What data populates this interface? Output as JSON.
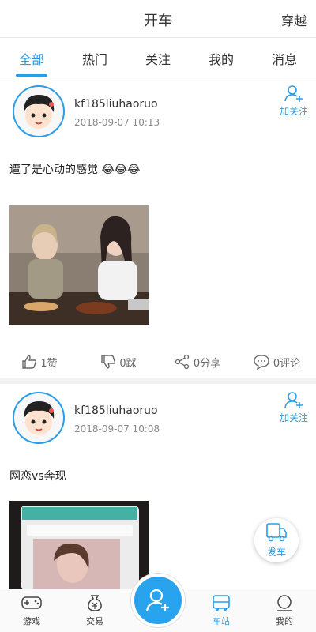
{
  "header": {
    "title": "开车",
    "action": "穿越"
  },
  "tabs": [
    {
      "label": "全部",
      "active": true
    },
    {
      "label": "热门",
      "active": false
    },
    {
      "label": "关注",
      "active": false
    },
    {
      "label": "我的",
      "active": false
    },
    {
      "label": "消息",
      "active": false
    }
  ],
  "posts": [
    {
      "username": "kf185liuhaoruo",
      "time": "2018-09-07 10:13",
      "follow_label": "加关注",
      "text": "遭了是心动的感觉",
      "emoji": "😂😂😂",
      "likes": "1赞",
      "dislikes": "0踩",
      "shares": "0分享",
      "comments": "0评论"
    },
    {
      "username": "kf185liuhaoruo",
      "time": "2018-09-07 10:08",
      "follow_label": "加关注",
      "text": "网恋vs奔现",
      "emoji": ""
    }
  ],
  "fab": {
    "label": "发车"
  },
  "bottom_nav": [
    {
      "label": "游戏",
      "icon": "gamepad-icon"
    },
    {
      "label": "交易",
      "icon": "money-bag-icon"
    },
    {
      "label": "车站",
      "icon": "bus-icon",
      "active": true
    },
    {
      "label": "我的",
      "icon": "user-icon"
    }
  ],
  "colors": {
    "accent": "#2a9de8",
    "center_button": "#2aa3ee"
  }
}
